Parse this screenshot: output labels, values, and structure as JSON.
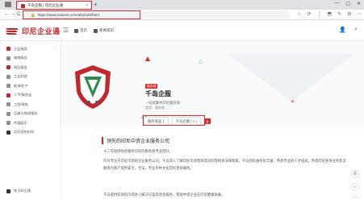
{
  "browser": {
    "tab_title": "千岛企服 | 印尼企业通",
    "tab_close": "×",
    "new_tab": "+",
    "url": "https://www.indoent.com/abo/228/html",
    "back": "←",
    "forward": "→",
    "reload": "C",
    "window_controls": [
      "—",
      "▢",
      "✕"
    ],
    "toolbar_icons": [
      "☆",
      "⟳",
      "⋮",
      "⬒",
      "✎",
      "⚙",
      "⋯"
    ]
  },
  "site": {
    "logo_text": "印尼企业通",
    "nav": [
      {
        "label": "首页",
        "icon": "home-icon"
      },
      {
        "label": "新闻资讯",
        "icon": "news-icon"
      }
    ],
    "header_icons": [
      "user-icon",
      "search-icon"
    ],
    "user_glyph": "👤",
    "search_glyph": "⌕"
  },
  "sidebar": {
    "items": [
      {
        "label": "企业服务",
        "icon": "red",
        "caret": "›"
      },
      {
        "label": "电商服务",
        "icon": "gray"
      },
      {
        "label": "地区服务",
        "icon": "red"
      },
      {
        "label": "工业制造",
        "icon": "gray"
      },
      {
        "label": "能源/矿产",
        "icon": "gray"
      },
      {
        "label": "二手/服务业",
        "icon": "red"
      },
      {
        "label": "工程/建筑",
        "icon": "gray"
      },
      {
        "label": "运输与物流服务",
        "icon": "gray"
      },
      {
        "label": "传媒娱乐",
        "icon": "gray"
      },
      {
        "label": "印尼领先机构",
        "icon": "dark"
      }
    ],
    "bottom_label": "关于印企通"
  },
  "hero": {
    "tag": "服务商",
    "company_name": "千岛企服",
    "subtitle": "一站式集中印尼服务商",
    "meta": "类型：服务商...",
    "buttons": [
      "服务商品 1",
      "千岛企服 ( 1 )"
    ],
    "action_glyph": "❯",
    "deco_triangle": "△",
    "deco_x": "✕"
  },
  "content": {
    "section_title": "领先的印尼中资企业服务公司",
    "para1": "十二年国际经验服务印尼的服务商专业团队。",
    "para2": "作为专注于印尼市场的企业服务公司，千岛深入了解印尼市场营商及风险等相关法律政策，千岛团队由经验丰富、熟悉专业的人才组成，熟悉印尼各项业务及流程。",
    "para3": "能够为客户提供安全、合法、专业的中文化印尼营商服务。",
    "para4": "千岛提供有效的市场进入解决方案及资金服务，帮助中资企业在印尼健康发展。"
  },
  "float_tools": [
    "☰",
    "⌕",
    "↑"
  ],
  "colors": {
    "brand_red": "#c0282d",
    "accent_red": "#e0282c",
    "accent_green": "#4cc38a"
  }
}
